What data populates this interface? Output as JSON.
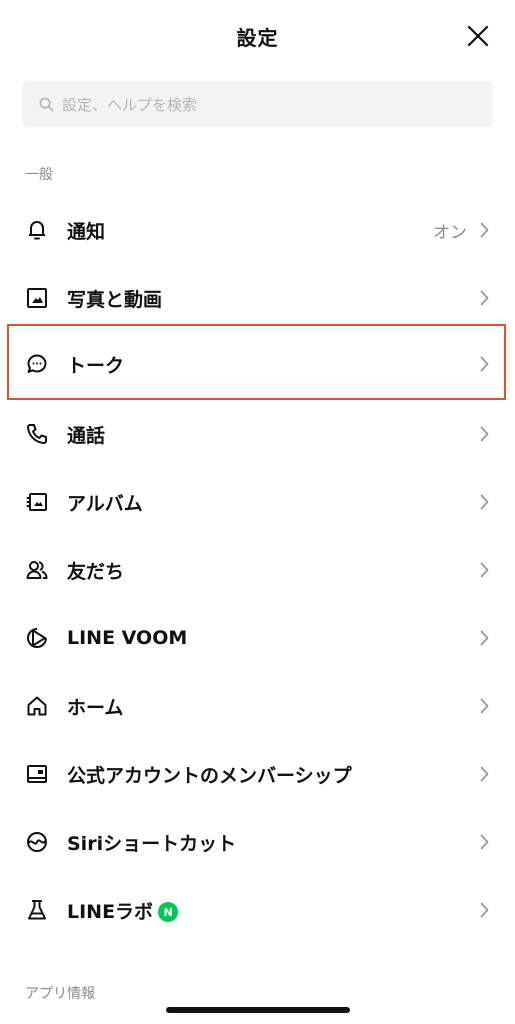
{
  "header": {
    "title": "設定"
  },
  "search": {
    "placeholder": "設定、ヘルプを検索"
  },
  "sections": {
    "general": "一般",
    "app_info": "アプリ情報"
  },
  "items": [
    {
      "label": "通知",
      "value": "オン",
      "icon": "bell-icon"
    },
    {
      "label": "写真と動画",
      "icon": "photo-icon"
    },
    {
      "label": "トーク",
      "icon": "chat-bubble-icon",
      "highlighted": true
    },
    {
      "label": "通話",
      "icon": "phone-icon"
    },
    {
      "label": "アルバム",
      "icon": "album-icon"
    },
    {
      "label": "友だち",
      "icon": "friends-icon"
    },
    {
      "label": "LINE VOOM",
      "icon": "voom-play-icon"
    },
    {
      "label": "ホーム",
      "icon": "home-icon"
    },
    {
      "label": "公式アカウントのメンバーシップ",
      "icon": "membership-card-icon"
    },
    {
      "label": "Siriショートカット",
      "icon": "siri-icon"
    },
    {
      "label": "LINEラボ",
      "icon": "flask-icon",
      "badge": "N"
    }
  ],
  "colors": {
    "highlight_border": "#e0522f",
    "badge_green": "#06c755",
    "secondary_text": "#8a8a8a",
    "search_bg": "#f3f3f3"
  }
}
